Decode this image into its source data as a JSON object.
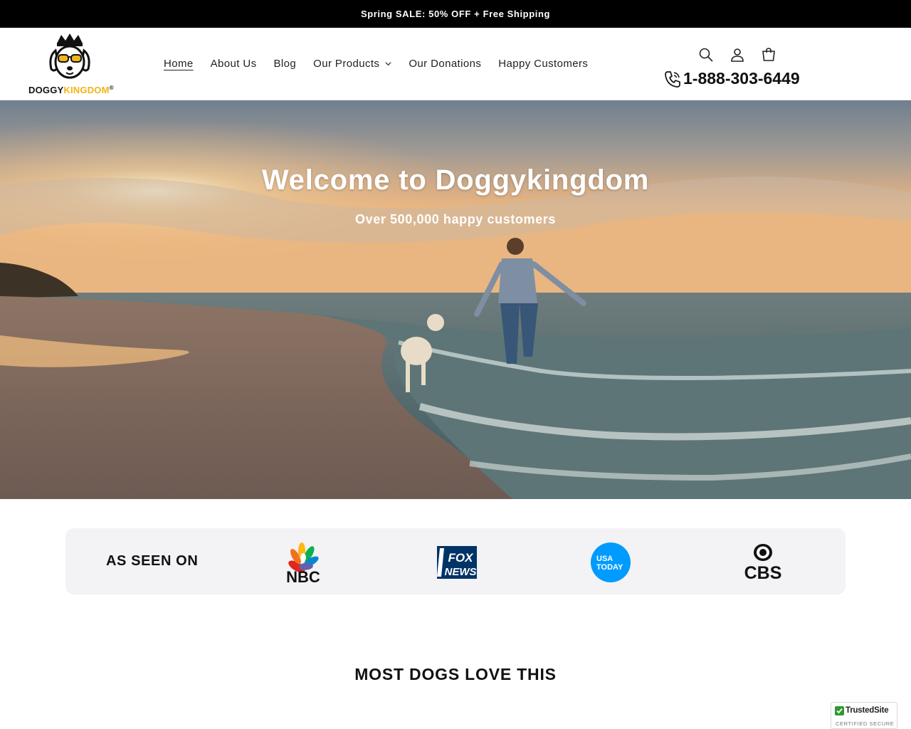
{
  "announcement": {
    "text": "Spring SALE: 50% OFF + Free Shipping"
  },
  "brand": {
    "name_part1": "DOGGY",
    "name_part2": "KINGDOM",
    "registered": "®",
    "accent_color": "#f2b418"
  },
  "nav": {
    "items": [
      {
        "label": "Home",
        "active": true
      },
      {
        "label": "About Us"
      },
      {
        "label": "Blog"
      },
      {
        "label": "Our Products",
        "has_dropdown": true
      },
      {
        "label": "Our Donations"
      },
      {
        "label": "Happy Customers"
      }
    ]
  },
  "header": {
    "icons": [
      "search-icon",
      "account-icon",
      "cart-icon"
    ],
    "phone": "1-888-303-6449"
  },
  "hero": {
    "title": "Welcome to Doggykingdom",
    "subtitle": "Over 500,000 happy customers"
  },
  "as_seen_on": {
    "label": "AS SEEN ON",
    "logos": [
      {
        "name": "NBC",
        "text": "NBC"
      },
      {
        "name": "Fox News",
        "text1": "FOX",
        "text2": "NEWS"
      },
      {
        "name": "USA Today",
        "text1": "USA",
        "text2": "TODAY"
      },
      {
        "name": "CBS",
        "text": "CBS"
      }
    ]
  },
  "section": {
    "title": "MOST DOGS LOVE THIS"
  },
  "trust_badge": {
    "title": "TrustedSite",
    "subtitle": "CERTIFIED SECURE"
  }
}
